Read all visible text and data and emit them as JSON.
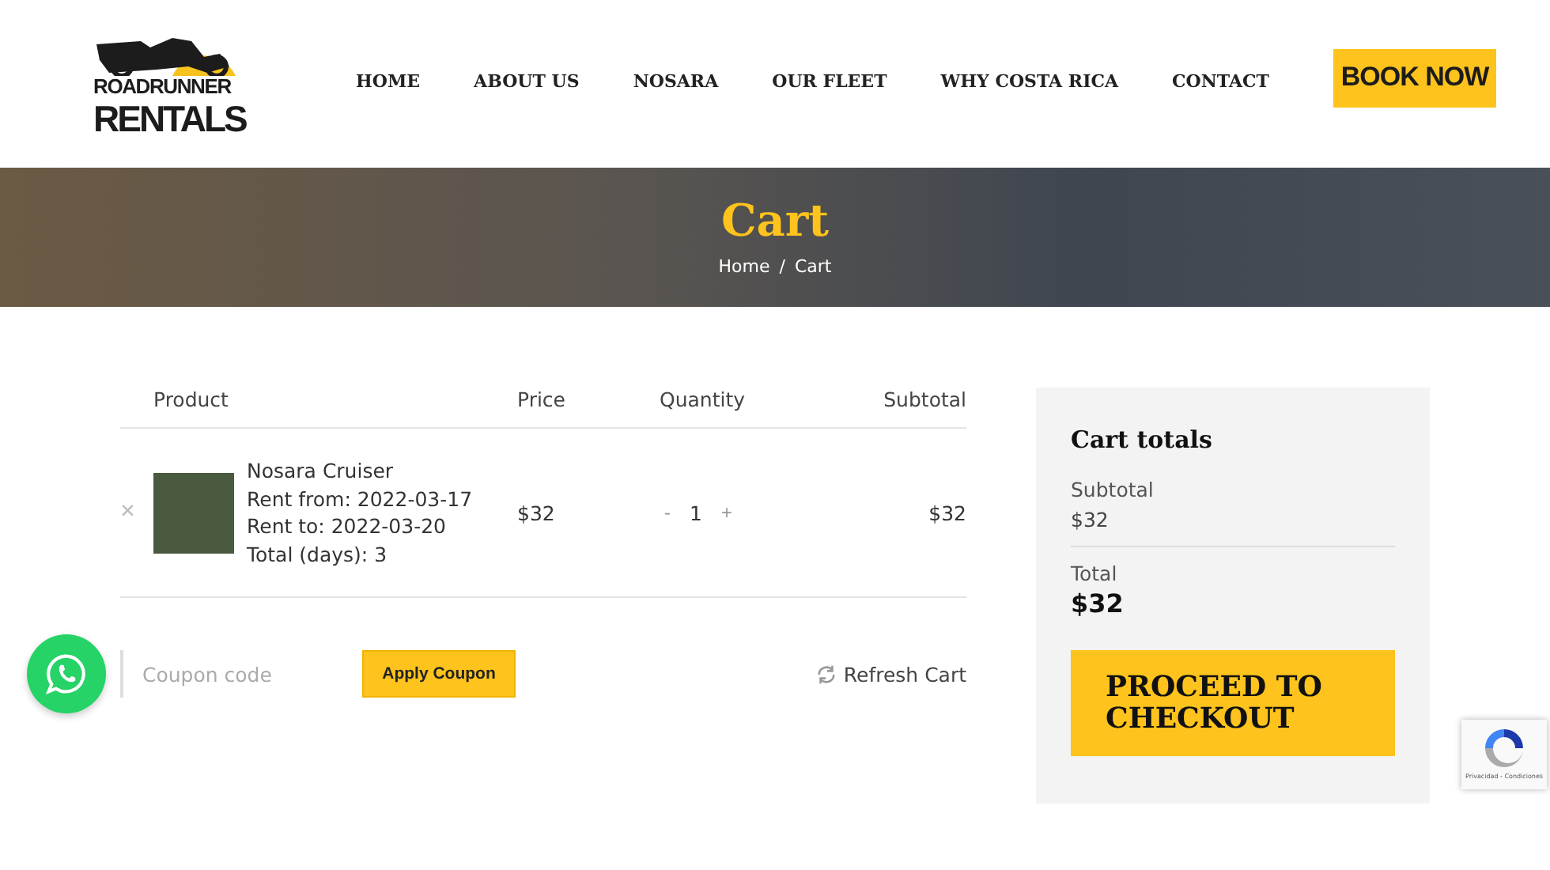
{
  "header": {
    "logo": {
      "line_1": "ROADRUNNER",
      "line_2": "RENTALS"
    },
    "nav": [
      {
        "label": "HOME"
      },
      {
        "label": "ABOUT US"
      },
      {
        "label": "NOSARA"
      },
      {
        "label": "OUR FLEET"
      },
      {
        "label": "WHY COSTA RICA"
      },
      {
        "label": "CONTACT"
      }
    ],
    "cta": "BOOK NOW"
  },
  "banner": {
    "title": "Cart",
    "breadcrumb": [
      "Home",
      "Cart"
    ],
    "separator": "/"
  },
  "cart": {
    "columns": [
      "Product",
      "Price",
      "Quantity",
      "Subtotal"
    ],
    "rows": [
      {
        "remove": "×",
        "name": "Nosara Cruiser",
        "details": [
          "Rent from: 2022-03-17",
          "Rent to: 2022-03-20",
          "Total (days): 3"
        ],
        "price": "$32",
        "minus": "-",
        "quantity": "1",
        "plus": "+",
        "subtotal": "$32"
      }
    ],
    "coupon": {
      "placeholder": "Coupon code"
    },
    "apply": "Apply Coupon",
    "refresh": "Refresh Cart"
  },
  "totals": {
    "title": "Cart totals",
    "subtotal_label": "Subtotal",
    "subtotal": "$32",
    "total_label": "Total",
    "total": "$32",
    "checkout": "PROCEED TO CHECKOUT"
  },
  "recaptcha": {
    "text": "Privacidad - Condiciones"
  }
}
